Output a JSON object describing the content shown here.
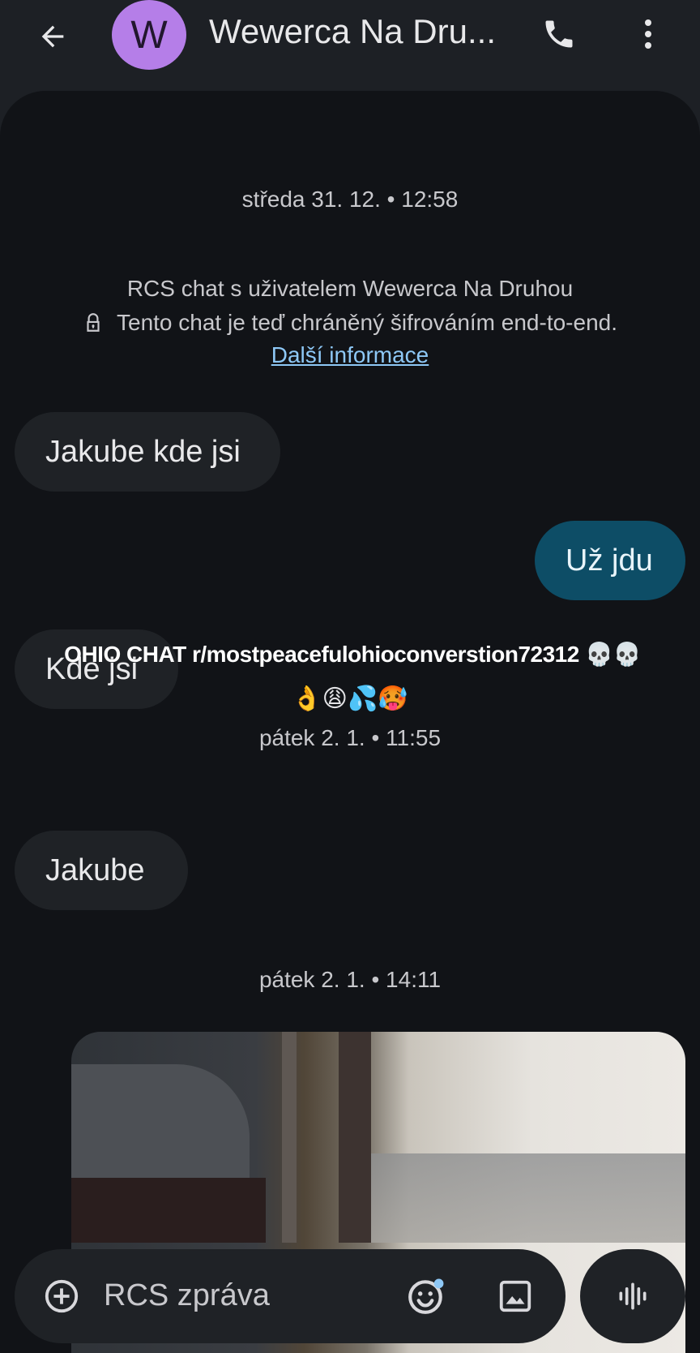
{
  "header": {
    "avatar_letter": "W",
    "title": "Wewerca Na Dru...",
    "back_icon": "arrow-back-icon",
    "call_icon": "phone-icon",
    "more_icon": "more-vert-icon"
  },
  "conversation": {
    "timestamp1": "středa 31. 12. • 12:58",
    "info_line1": "RCS chat s uživatelem Wewerca Na Druhou",
    "info_line2": "Tento chat je teď chráněný šifrováním end-to-end.",
    "info_link": "Další informace",
    "msg1": "Jakube kde jsi",
    "msg2": "Už jdu",
    "msg3": "Kde jsi",
    "overlay_caption": "OHIO CHAT r/mostpeacefulohioconverstion72312 💀💀",
    "overlay_emojis": "👌😩💦🥵",
    "timestamp2": "pátek 2. 1. • 11:55",
    "msg4": "Jakube",
    "timestamp3": "pátek 2. 1. • 14:11"
  },
  "composer": {
    "placeholder": "RCS zpráva",
    "add_icon": "add-circle-icon",
    "emoji_icon": "emoji-icon",
    "gallery_icon": "gallery-icon",
    "voice_icon": "voice-waveform-icon"
  },
  "colors": {
    "background": "#1d2025",
    "panel": "#111317",
    "incoming_bubble": "#1f2226",
    "outgoing_bubble": "#0d4d66",
    "avatar": "#b57ee8",
    "link": "#8ec8f6"
  }
}
